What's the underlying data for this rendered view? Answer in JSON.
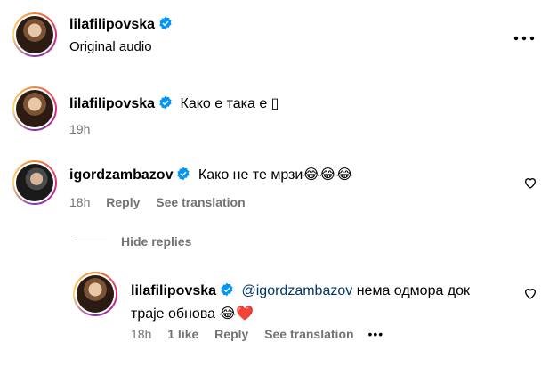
{
  "header": {
    "username": "lilafilipovska",
    "subtitle": "Original audio"
  },
  "caption": {
    "username": "lilafilipovska",
    "text": "Како е така е ▯",
    "time": "19h"
  },
  "comment1": {
    "username": "igordzambazov",
    "text": "Како не те мрзи",
    "emojis": "😂😂😂",
    "time": "18h",
    "reply_label": "Reply",
    "translation_label": "See translation"
  },
  "replies_toggle": {
    "label": "Hide replies"
  },
  "reply1": {
    "username": "lilafilipovska",
    "mention": "@igordzambazov",
    "text_line1": "нема одмора док",
    "text_line2": "траје обнова",
    "emojis": "😂❤️",
    "time": "18h",
    "likes": "1 like",
    "reply_label": "Reply",
    "translation_label": "See translation",
    "more": "•••"
  },
  "colors": {
    "verified": "#0095f6",
    "meta_text": "#737373",
    "mention": "#00376b"
  }
}
